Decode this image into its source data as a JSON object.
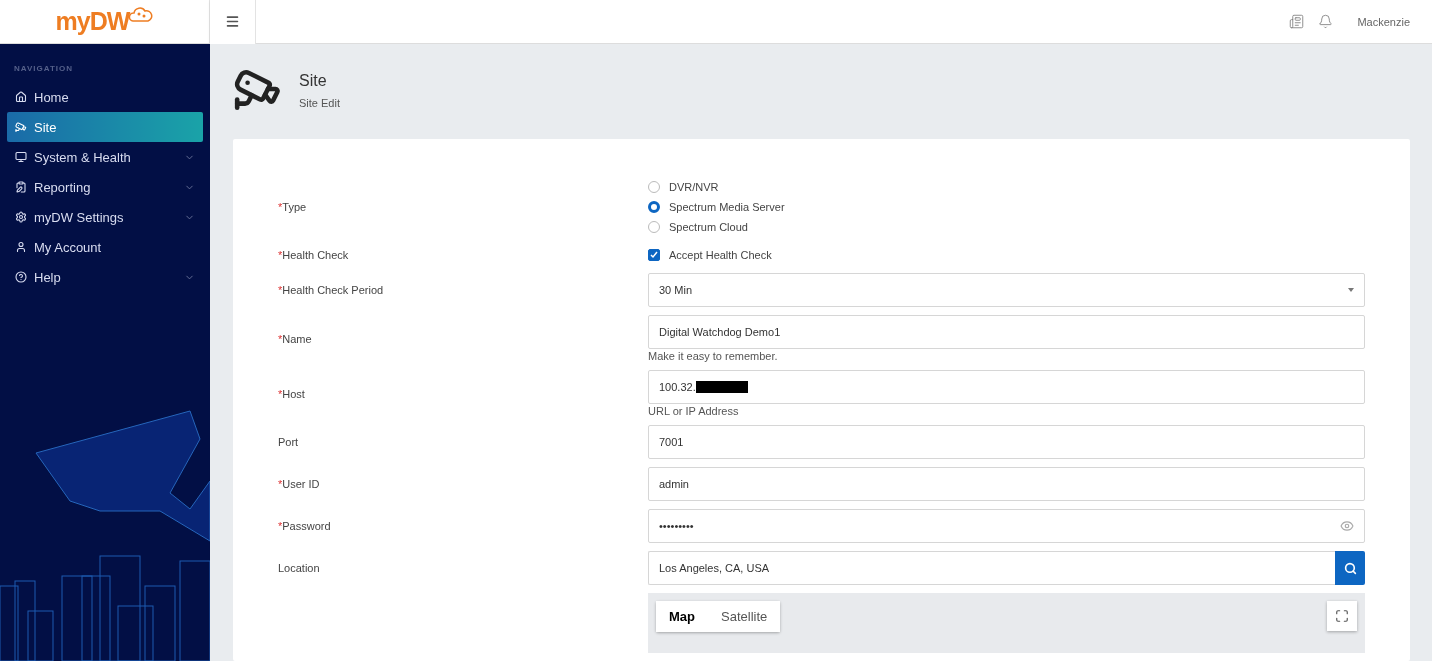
{
  "logo": {
    "text": "myDW"
  },
  "topbar": {
    "user": "Mackenzie"
  },
  "sidebar": {
    "heading": "NAVIGATION",
    "items": [
      {
        "kind": "home",
        "label": "Home",
        "selected": false,
        "expandable": false
      },
      {
        "kind": "site",
        "label": "Site",
        "selected": true,
        "expandable": false
      },
      {
        "kind": "monitor",
        "label": "System & Health",
        "selected": false,
        "expandable": true
      },
      {
        "kind": "report",
        "label": "Reporting",
        "selected": false,
        "expandable": true
      },
      {
        "kind": "settings",
        "label": "myDW Settings",
        "selected": false,
        "expandable": true
      },
      {
        "kind": "account",
        "label": "My Account",
        "selected": false,
        "expandable": false
      },
      {
        "kind": "help",
        "label": "Help",
        "selected": false,
        "expandable": true
      }
    ]
  },
  "page": {
    "title": "Site",
    "subtitle": "Site Edit"
  },
  "form": {
    "fields": [
      {
        "kind": "radio",
        "label": "Type",
        "required_mark": "*",
        "options": [
          {
            "label": "DVR/NVR",
            "selected": false
          },
          {
            "label": "Spectrum Media Server",
            "selected": true
          },
          {
            "label": "Spectrum Cloud",
            "selected": false
          }
        ]
      },
      {
        "kind": "checkbox",
        "label": "Health Check",
        "required_mark": "*",
        "option": "Accept Health Check",
        "checked": true
      },
      {
        "kind": "select",
        "label": "Health Check Period",
        "required_mark": "*",
        "value": "30 Min"
      },
      {
        "kind": "text",
        "label": "Name",
        "required_mark": "*",
        "value": "Digital Watchdog Demo1",
        "hint": "Make it easy to remember."
      },
      {
        "kind": "text",
        "label": "Host",
        "required_mark": "*",
        "value": "100.32.",
        "redacted": true,
        "hint": "URL or IP Address"
      },
      {
        "kind": "text",
        "label": "Port",
        "value": "7001"
      },
      {
        "kind": "text",
        "label": "User ID",
        "required_mark": "*",
        "value": "admin"
      },
      {
        "kind": "password",
        "label": "Password",
        "required_mark": "*",
        "value": "•••••••••"
      },
      {
        "kind": "search",
        "label": "Location",
        "value": "Los Angeles, CA, USA"
      }
    ]
  },
  "map": {
    "types": [
      {
        "label": "Map",
        "selected": true
      },
      {
        "label": "Satellite",
        "selected": false
      }
    ]
  }
}
